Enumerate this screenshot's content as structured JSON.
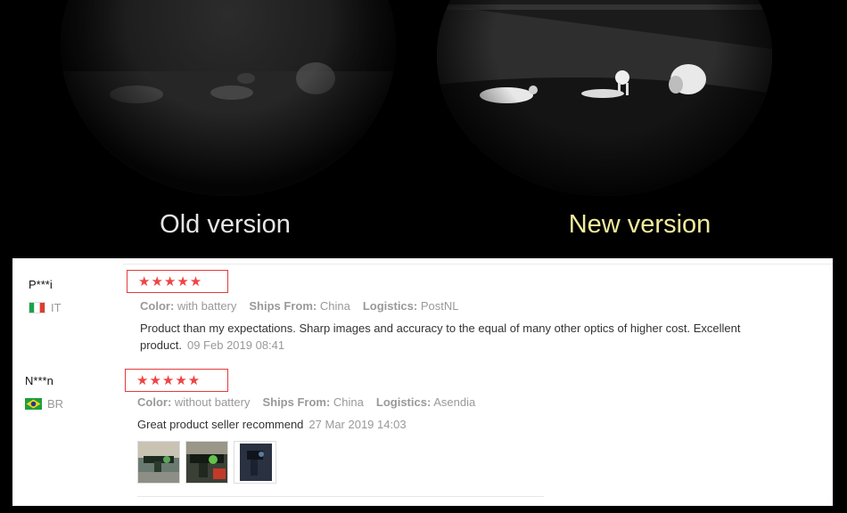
{
  "banner": {
    "old_caption": "Old version",
    "new_caption": "New version",
    "new_caption_color": "#f1eb9c"
  },
  "reviews": [
    {
      "user": "P***i",
      "country": "IT",
      "flag": "flag-italy-icon",
      "stars": 5,
      "stars_text": "★★★★★",
      "color_label": "Color:",
      "color_value": "with battery",
      "ships_label": "Ships From:",
      "ships_value": "China",
      "logistics_label": "Logistics:",
      "logistics_value": "PostNL",
      "text": "Product than my expectations. Sharp images and accuracy to the equal of many other optics of higher cost. Excellent product.",
      "date": "09 Feb 2019 08:41",
      "photos": 0
    },
    {
      "user": "N***n",
      "country": "BR",
      "flag": "flag-brazil-icon",
      "stars": 5,
      "stars_text": "★★★★★",
      "color_label": "Color:",
      "color_value": "without battery",
      "ships_label": "Ships From:",
      "ships_value": "China",
      "logistics_label": "Logistics:",
      "logistics_value": "Asendia",
      "text": "Great product seller recommend",
      "date": "27 Mar 2019 14:03",
      "photos": 3
    }
  ],
  "colors": {
    "star": "#ef4444",
    "star_box": "#e33b3b",
    "meta": "#999999"
  }
}
